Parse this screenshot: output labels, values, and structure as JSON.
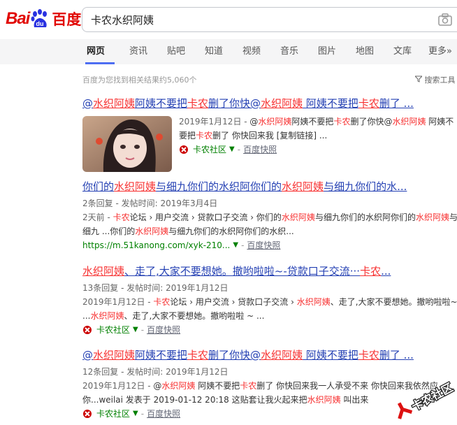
{
  "search": {
    "query": "卡农水织阿姨"
  },
  "logo": {
    "text_bai": "Bai",
    "text_du": "百度",
    "paw_text": "du"
  },
  "tabs": [
    "网页",
    "资讯",
    "贴吧",
    "知道",
    "视频",
    "音乐",
    "图片",
    "地图",
    "文库",
    "更多»"
  ],
  "meta": {
    "count_text": "百度为您找到相关结果约5,060个",
    "tools_text": "搜索工具"
  },
  "results": [
    {
      "title": [
        [
          "@",
          0
        ],
        [
          "水织阿姨",
          1
        ],
        [
          "阿姨不要把",
          0
        ],
        [
          "卡农",
          1
        ],
        [
          "删了你快@",
          0
        ],
        [
          "水织阿姨",
          1
        ],
        [
          " 阿姨不要把",
          0
        ],
        [
          "卡农",
          1
        ],
        [
          "删了 ...",
          0
        ]
      ],
      "abs": [
        [
          "2019年1月12日 - ",
          2
        ],
        [
          "@",
          0
        ],
        [
          "水织阿姨",
          1
        ],
        [
          "阿姨不要把",
          0
        ],
        [
          "卡农",
          1
        ],
        [
          "删了你快@",
          0
        ],
        [
          "水织阿姨",
          1
        ],
        [
          " 阿姨不要把",
          0
        ],
        [
          "卡农",
          1
        ],
        [
          "删了 你快回来我 [复制链接] ...",
          0
        ]
      ],
      "source": {
        "site": "卡农社区",
        "snap": "百度快照"
      }
    },
    {
      "title": [
        [
          "你们的",
          0
        ],
        [
          "水织阿姨",
          1
        ],
        [
          "与细九你们的水织阿你们的",
          0
        ],
        [
          "水织阿姨",
          1
        ],
        [
          "与细九你们的水...",
          0
        ]
      ],
      "meta": "2条回复 - 发帖时间: 2019年3月4日",
      "abs": [
        [
          "2天前 - ",
          2
        ],
        [
          "卡农",
          1
        ],
        [
          "论坛 › 用户交流 › 贷款口子交流 › 你们的",
          0
        ],
        [
          "水织阿姨",
          1
        ],
        [
          "与细九你们的水织阿你们的",
          0
        ],
        [
          "水织阿姨",
          1
        ],
        [
          "与细九 ...你们的",
          0
        ],
        [
          "水织阿姨",
          1
        ],
        [
          "与细九你们的水织阿你们的水织...",
          0
        ]
      ],
      "source": {
        "site": "https://m.51kanong.com/xyk-210...",
        "snap": "百度快照"
      }
    },
    {
      "title": [
        [
          "水织阿姨",
          1
        ],
        [
          "、走了,大家不要想她。撤哟啦啦~-贷款口子交流···",
          0
        ],
        [
          "卡农",
          1
        ],
        [
          "...",
          0
        ]
      ],
      "meta": "13条回复 - 发帖时间: 2019年1月12日",
      "abs": [
        [
          "2019年1月12日 - ",
          2
        ],
        [
          "卡农",
          1
        ],
        [
          "论坛 › 用户交流 › 贷款口子交流 › ",
          0
        ],
        [
          "水织阿姨",
          1
        ],
        [
          "、走了,大家不要想她。撤哟啦啦~ ...",
          0
        ],
        [
          "水织阿姨",
          1
        ],
        [
          "、走了,大家不要想她。撤哟啦啦 ~ ...",
          0
        ]
      ],
      "source": {
        "site": "卡农社区",
        "snap": "百度快照"
      }
    },
    {
      "title": [
        [
          "@",
          0
        ],
        [
          "水织阿姨",
          1
        ],
        [
          "阿姨不要把",
          0
        ],
        [
          "卡农",
          1
        ],
        [
          "删了你快@",
          0
        ],
        [
          "水织阿姨",
          1
        ],
        [
          " 阿姨不要把",
          0
        ],
        [
          "卡农",
          1
        ],
        [
          "删了 ...",
          0
        ]
      ],
      "meta": "12条回复 - 发帖时间: 2019年1月12日",
      "abs": [
        [
          "2019年1月12日 - ",
          2
        ],
        [
          "@",
          0
        ],
        [
          "水织阿姨",
          1
        ],
        [
          " 阿姨不要把",
          0
        ],
        [
          "卡农",
          1
        ],
        [
          "删了 你快回来我一人承受不来 你快回来我依然应你...weilai 发表于 2019-01-12 20:18 这贴套让我火起来把",
          0
        ],
        [
          "水织阿姨",
          1
        ],
        [
          " 叫出来",
          0
        ]
      ],
      "source": {
        "site": "卡农社区",
        "snap": "百度快照"
      }
    }
  ],
  "watermark": {
    "text": "卡农社区"
  },
  "colors": {
    "brand_red": "#e10602",
    "brand_blue": "#2932e1",
    "link": "#2440b3",
    "highlight": "#f73131",
    "source_green": "#008000"
  }
}
